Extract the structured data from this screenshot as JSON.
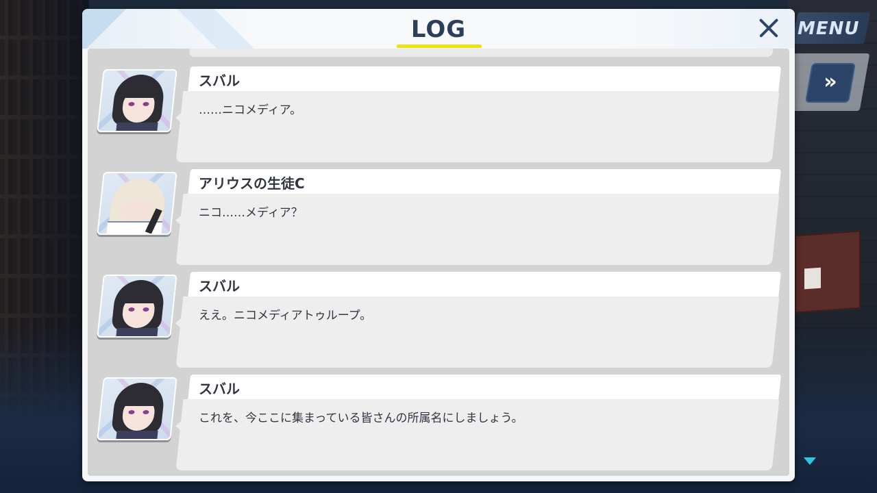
{
  "top_controls": {
    "menu_label": "MENU",
    "skip_icon": "fast-forward-icon",
    "skip_glyph": "»"
  },
  "log_window": {
    "title": "LOG",
    "close_icon": "close-icon",
    "scroll_indicator_icon": "scroll-down-arrow-icon"
  },
  "entries": [
    {
      "speaker": "スバル",
      "text": "……ニコメディア。",
      "portrait": "dark-hair-smiling"
    },
    {
      "speaker": "アリウスの生徒C",
      "text": "ニコ……メディア？",
      "portrait": "light-hair-masked"
    },
    {
      "speaker": "スバル",
      "text": "ええ。ニコメディアトゥループ。",
      "portrait": "dark-hair-grinning"
    },
    {
      "speaker": "スバル",
      "text": "これを、今ここに集まっている皆さんの所属名にしましょう。",
      "portrait": "dark-hair-smiling"
    }
  ],
  "colors": {
    "title_underline": "#f2e012",
    "title_text": "#2b3f5a",
    "close_icon": "#2b4468",
    "skip_button": "#2b4468",
    "scroll_arrow": "#2fc6e0"
  }
}
